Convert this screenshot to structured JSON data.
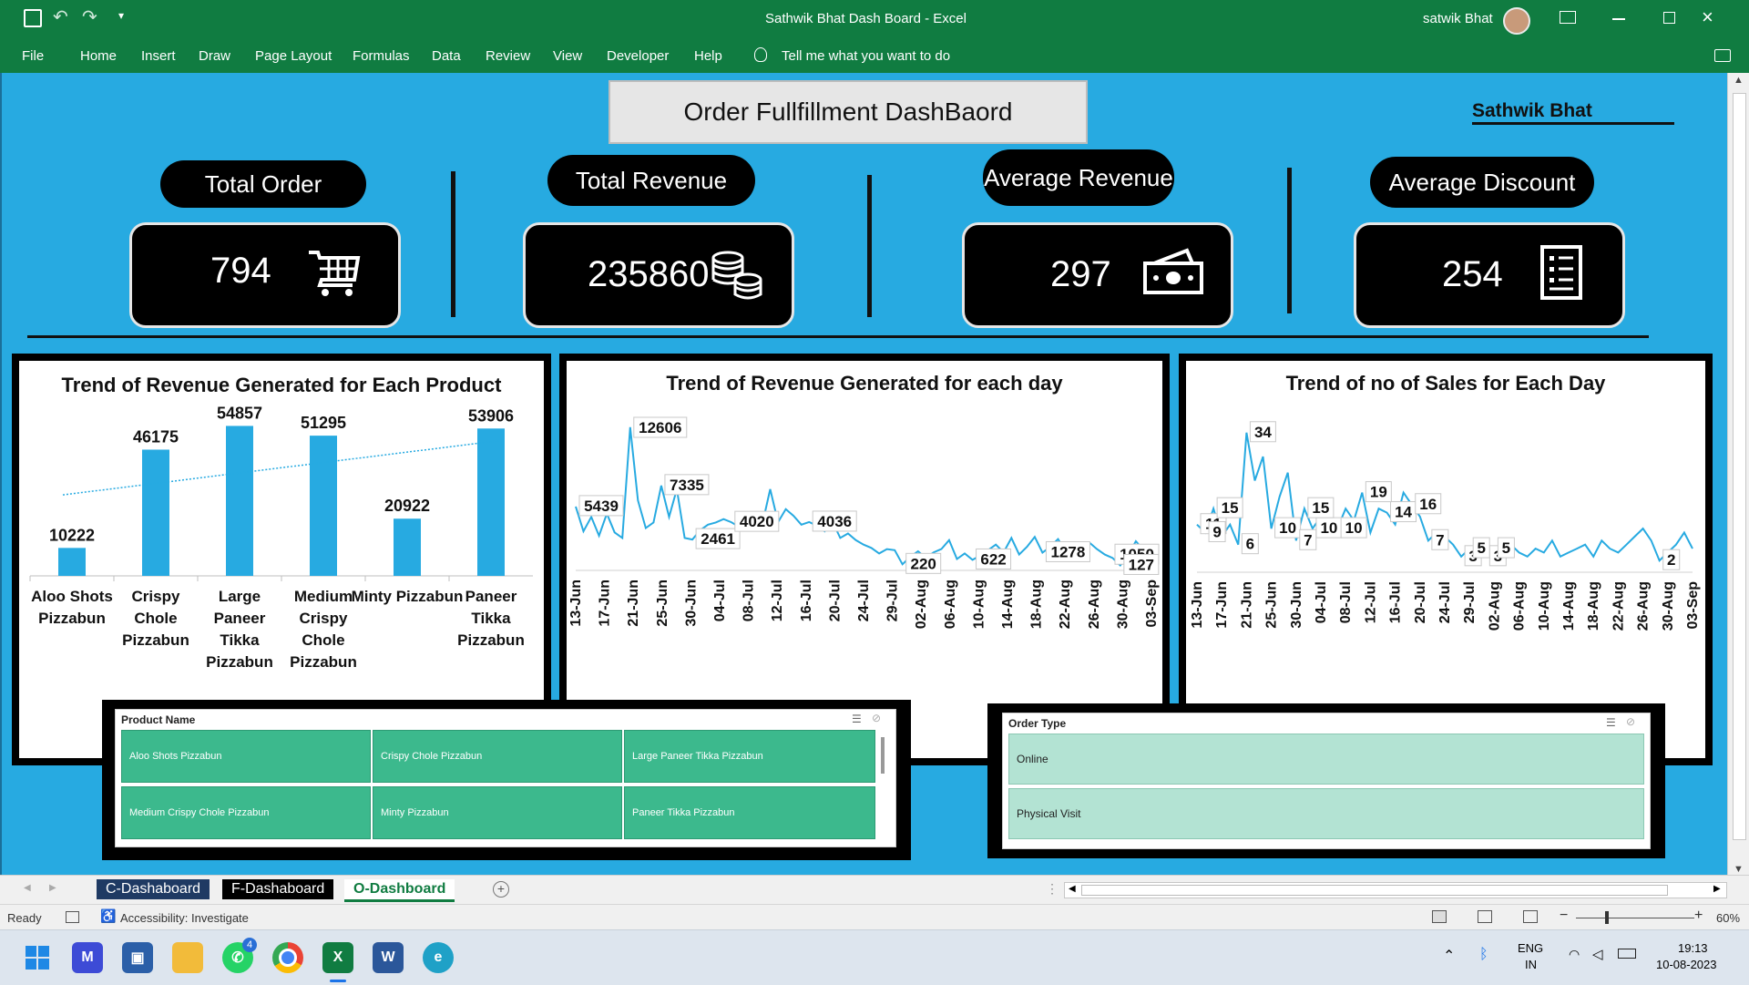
{
  "window": {
    "title": "Sathwik Bhat Dash Board  -  Excel",
    "user": "satwik Bhat"
  },
  "ribbon": {
    "tabs": [
      "File",
      "Home",
      "Insert",
      "Draw",
      "Page Layout",
      "Formulas",
      "Data",
      "Review",
      "View",
      "Developer",
      "Help"
    ],
    "tell_me": "Tell me what you want to do"
  },
  "dashboard": {
    "title": "Order Fullfillment DashBaord",
    "author": "Sathwik  Bhat",
    "kpis": [
      {
        "label": "Total Order",
        "value": "794",
        "icon": "cart-icon"
      },
      {
        "label": "Total Revenue",
        "value": "235860",
        "icon": "coins-icon"
      },
      {
        "label": "Average Revenue",
        "value": "297",
        "icon": "cash-icon"
      },
      {
        "label": "Average Discount",
        "value": "254",
        "icon": "receipt-icon"
      }
    ]
  },
  "chart_data": [
    {
      "type": "bar",
      "title": "Trend of Revenue Generated for Each Product",
      "categories": [
        "Aloo Shots Pizzabun",
        "Crispy Chole Pizzabun",
        "Large Paneer Tikka Pizzabun",
        "Medium Crispy Chole Pizzabun",
        "Minty Pizzabun",
        "Paneer Tikka Pizzabun"
      ],
      "values": [
        10222,
        46175,
        54857,
        51295,
        20922,
        53906
      ],
      "trendline": true,
      "color": "#27aae1"
    },
    {
      "type": "line",
      "title": "Trend of Revenue Generated for each day",
      "x_ticks": [
        "13-Jun",
        "17-Jun",
        "21-Jun",
        "25-Jun",
        "30-Jun",
        "04-Jul",
        "08-Jul",
        "12-Jul",
        "16-Jul",
        "20-Jul",
        "24-Jul",
        "29-Jul",
        "02-Aug",
        "06-Aug",
        "10-Aug",
        "14-Aug",
        "18-Aug",
        "22-Aug",
        "26-Aug",
        "30-Aug",
        "03-Sep"
      ],
      "values": [
        5439,
        3200,
        4500,
        2800,
        4800,
        3100,
        2600,
        12606,
        6000,
        3500,
        4000,
        7335,
        4500,
        7000,
        2600,
        2461,
        3300,
        3800,
        4000,
        4300,
        4020,
        3600,
        4200,
        4800,
        3900,
        7000,
        4020,
        5200,
        4600,
        3800,
        4036,
        3700,
        3200,
        4100,
        2600,
        3000,
        2400,
        2000,
        1700,
        1200,
        1600,
        1500,
        220,
        900,
        1400,
        800,
        1300,
        1600,
        2400,
        700,
        1200,
        622,
        1000,
        1500,
        2000,
        1300,
        2600,
        1100,
        1800,
        2700,
        1278,
        1800,
        2500,
        1300,
        900,
        1900,
        2200,
        1600,
        1100,
        800,
        127,
        1050,
        2300,
        1500,
        1050
      ],
      "data_labels": [
        "12606",
        "7335",
        "5439",
        "2461",
        "4020",
        "4036",
        "220",
        "622",
        "1278",
        "1050",
        "127"
      ],
      "color": "#27aae1"
    },
    {
      "type": "line",
      "title": "Trend of no of Sales for Each Day",
      "x_ticks": [
        "13-Jun",
        "17-Jun",
        "21-Jun",
        "25-Jun",
        "30-Jun",
        "04-Jul",
        "08-Jul",
        "12-Jul",
        "16-Jul",
        "20-Jul",
        "24-Jul",
        "29-Jul",
        "02-Aug",
        "06-Aug",
        "10-Aug",
        "14-Aug",
        "18-Aug",
        "22-Aug",
        "26-Aug",
        "30-Aug",
        "03-Sep"
      ],
      "values": [
        11,
        9,
        15,
        8,
        11,
        6,
        34,
        22,
        28,
        10,
        18,
        24,
        7,
        15,
        10,
        13,
        8,
        10,
        15,
        12,
        19,
        9,
        15,
        14,
        11,
        19,
        16,
        13,
        7,
        9,
        8,
        6,
        3,
        5,
        4,
        3,
        5,
        3,
        6,
        4,
        3,
        5,
        4,
        7,
        3,
        4,
        5,
        6,
        3,
        7,
        5,
        4,
        6,
        8,
        10,
        7,
        2,
        4,
        6,
        9,
        5
      ],
      "data_labels": [
        "34",
        "11",
        "15",
        "10",
        "10",
        "15",
        "14",
        "19",
        "16",
        "7",
        "6",
        "3",
        "3",
        "5",
        "7",
        "10",
        "2",
        "9",
        "5"
      ],
      "color": "#27aae1"
    }
  ],
  "slicers": {
    "product": {
      "header": "Product Name",
      "items": [
        "Aloo Shots Pizzabun",
        "Crispy Chole Pizzabun",
        "Large Paneer Tikka Pizzabun",
        "Medium Crispy Chole Pizzabun",
        "Minty Pizzabun",
        "Paneer Tikka Pizzabun"
      ]
    },
    "order_type": {
      "header": "Order Type",
      "items": [
        "Online",
        "Physical Visit"
      ]
    }
  },
  "sheets": [
    "C-Dashaboard",
    "F-Dashaboard",
    "O-Dashboard"
  ],
  "status": {
    "ready": "Ready",
    "accessibility": "Accessibility: Investigate",
    "zoom": "60%"
  },
  "taskbar": {
    "lang": "ENG",
    "region": "IN",
    "time": "19:13",
    "date": "10-08-2023",
    "whatsapp_badge": "4"
  }
}
